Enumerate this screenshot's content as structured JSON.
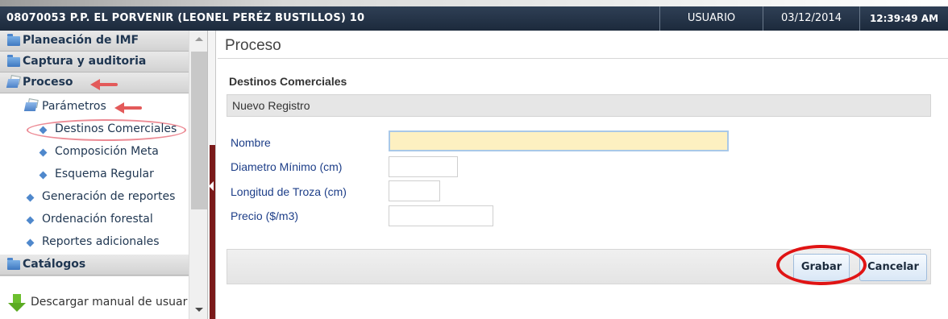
{
  "header": {
    "title": "08070053 P.P. EL PORVENIR (LEONEL PERÉZ BUSTILLOS) 10",
    "user": "USUARIO",
    "date": "03/12/2014",
    "time": "12:39:49 AM"
  },
  "sidebar": {
    "sections": {
      "planeacion": "Planeación de IMF",
      "captura": "Captura y auditoria",
      "proceso": "Proceso",
      "parametros": "Parámetros",
      "catalogos": "Catálogos"
    },
    "items": {
      "destinos": "Destinos Comerciales",
      "composicion": "Composición Meta",
      "esquema": "Esquema Regular",
      "generacion": "Generación de reportes",
      "ordenacion": "Ordenación forestal",
      "reportes": "Reportes adicionales"
    },
    "download_label": "Descargar manual de usuar"
  },
  "main": {
    "page_title": "Proceso",
    "section_title": "Destinos Comerciales",
    "sub_header": "Nuevo Registro",
    "fields": {
      "nombre": {
        "label": "Nombre",
        "value": ""
      },
      "diametro": {
        "label": "Diametro Mínimo (cm)",
        "value": ""
      },
      "longitud": {
        "label": "Longitud de Troza (cm)",
        "value": ""
      },
      "precio": {
        "label": "Precio ($/m3)",
        "value": ""
      }
    },
    "buttons": {
      "save": "Grabar",
      "cancel": "Cancelar"
    }
  },
  "colors": {
    "header_bg": "#243348",
    "label_blue": "#1d3e88",
    "annotation_red": "#e01414",
    "annotation_pink": "#e35a5a",
    "focus_input_bg": "#fdf0c1"
  },
  "icons": {
    "folder": "folder-icon",
    "open_folder": "open-folder-icon",
    "bullet": "diamond-bullet-icon",
    "download": "download-arrow-icon"
  }
}
